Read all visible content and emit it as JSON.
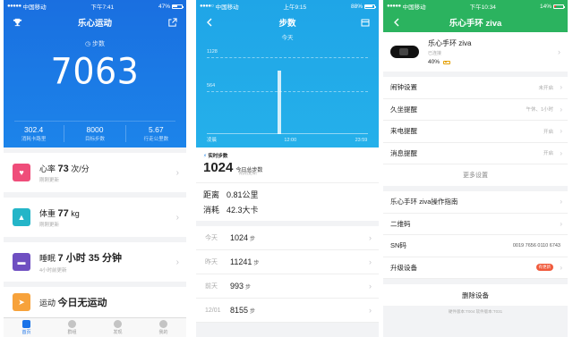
{
  "panel1": {
    "status": {
      "carrier": "中国移动",
      "time": "下午7:41",
      "battery": "47%"
    },
    "title": "乐心运动",
    "step_label": "步数",
    "steps": "7063",
    "stats": [
      {
        "value": "302.4",
        "label": "消耗卡路里"
      },
      {
        "value": "8000",
        "label": "目标步数"
      },
      {
        "value": "5.67",
        "label": "行走公里数"
      }
    ],
    "cards": [
      {
        "icon": "heart-icon",
        "color": "#ef4d7a",
        "name": "心率",
        "value": "73",
        "unit": "次/分",
        "sub": "刚刚更新"
      },
      {
        "icon": "weight-icon",
        "color": "#24b5c8",
        "name": "体重",
        "value": "77",
        "unit": "kg",
        "sub": "刚刚更新"
      },
      {
        "icon": "bed-icon",
        "color": "#6f4fc1",
        "name": "睡眠",
        "value": "7 小时 35 分钟",
        "unit": "",
        "sub": "4小时前更新"
      },
      {
        "icon": "run-icon",
        "color": "#f7a23b",
        "name": "运动",
        "value": "今日无运动",
        "unit": "",
        "sub": ""
      }
    ],
    "tabs": [
      {
        "label": "首页",
        "active": true
      },
      {
        "label": "群组",
        "active": false
      },
      {
        "label": "发现",
        "active": false
      },
      {
        "label": "我的",
        "active": false
      }
    ]
  },
  "panel2": {
    "status": {
      "carrier": "中国移动",
      "time": "上午9:15",
      "battery": "88%"
    },
    "title": "步数",
    "subtitle": "今天",
    "chart_data": {
      "type": "bar",
      "gridlines": [
        "1128",
        "564"
      ],
      "xlabels": [
        "凌晨",
        "12:00",
        "23:59"
      ],
      "bars": [
        {
          "pos": 0.44,
          "frac": 0.94
        }
      ]
    },
    "realtime": {
      "label": "实时步数",
      "steps": "1024",
      "steps_label": "今日总步数",
      "updated": "刚刚更新"
    },
    "distance": {
      "label": "距离",
      "value": "0.81公里"
    },
    "calories": {
      "label": "消耗",
      "value": "42.3大卡"
    },
    "history": [
      {
        "day": "今天",
        "steps": "1024",
        "unit": "步"
      },
      {
        "day": "昨天",
        "steps": "11241",
        "unit": "步"
      },
      {
        "day": "前天",
        "steps": "993",
        "unit": "步"
      },
      {
        "day": "12/01",
        "steps": "8155",
        "unit": "步"
      }
    ]
  },
  "panel3": {
    "status": {
      "carrier": "中国移动",
      "time": "下午10:34",
      "battery": "14%"
    },
    "title": "乐心手环 ziva",
    "device": {
      "name": "乐心手环 ziva",
      "status": "已连接",
      "battery": "40%"
    },
    "settings": [
      {
        "label": "闹钟设置",
        "value": "未开启"
      },
      {
        "label": "久坐提醒",
        "value": "午休、1小时"
      },
      {
        "label": "来电提醒",
        "value": "开启"
      },
      {
        "label": "消息提醒",
        "value": "开启"
      }
    ],
    "more": "更多设置",
    "links": [
      {
        "label": "乐心手环 ziva操作指南",
        "value": ""
      },
      {
        "label": "二维码",
        "value": ""
      },
      {
        "label": "SN码",
        "value": "0019 7656 0110 6743"
      },
      {
        "label": "升级设备",
        "value": "",
        "badge": "有更新"
      }
    ],
    "delete": "删除设备",
    "footer": "硬件版本:T004  软件版本:T031"
  }
}
